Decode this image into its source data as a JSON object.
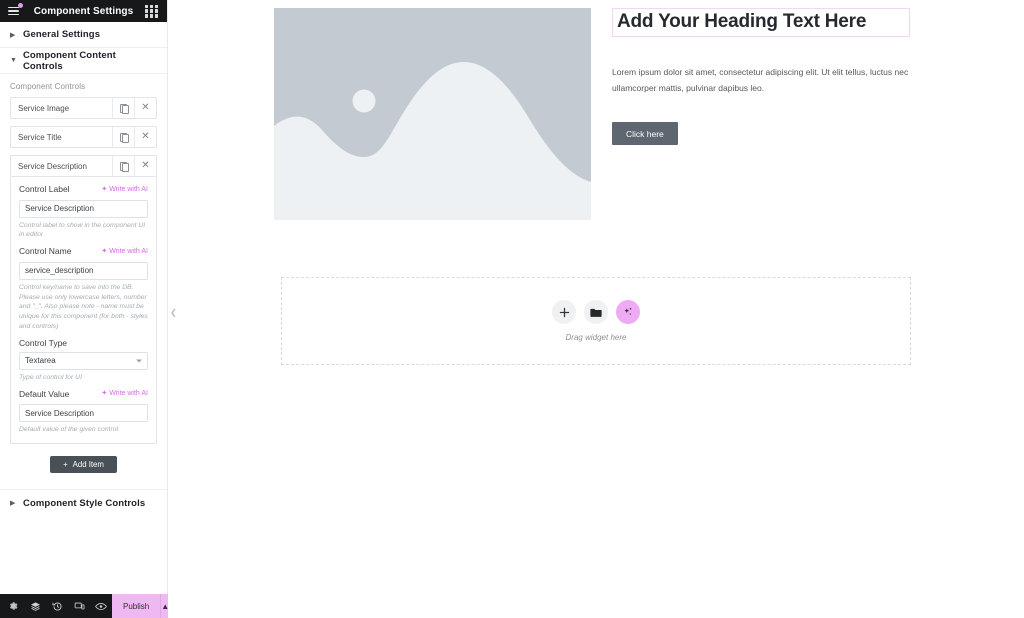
{
  "panel": {
    "title": "Component Settings",
    "menu_icon": "hamburger-icon",
    "apps_icon": "grid-icon",
    "sections": [
      {
        "id": "general",
        "label": "General Settings",
        "expanded": false
      },
      {
        "id": "content",
        "label": "Component Content Controls",
        "expanded": true
      },
      {
        "id": "style",
        "label": "Component Style Controls",
        "expanded": false
      }
    ],
    "content_controls": {
      "group_label": "Component Controls",
      "items": [
        {
          "title": "Service Image",
          "expanded": false
        },
        {
          "title": "Service Title",
          "expanded": false
        },
        {
          "title": "Service Description",
          "expanded": true
        }
      ],
      "expanded_item": {
        "control_label": {
          "label": "Control Label",
          "ai_action": "Write with AI",
          "value": "Service Description",
          "helper": "Control label to show in the component UI in editor"
        },
        "control_name": {
          "label": "Control Name",
          "ai_action": "Write with AI",
          "value": "service_description",
          "helper": "Control key/name to save into the DB. Please use only lowercase letters, number and \"_\". Also please note - name must be unique for this component (for both - styles and controls)"
        },
        "control_type": {
          "label": "Control Type",
          "value": "Textarea",
          "helper": "Type of control for UI"
        },
        "default_value": {
          "label": "Default Value",
          "ai_action": "Write with AI",
          "value": "Service Description",
          "helper": "Default value of the given control"
        },
        "row_actions": {
          "duplicate": "duplicate-icon",
          "remove": "remove-icon"
        }
      },
      "add_item_label": "Add Item"
    },
    "footer": {
      "tools": [
        {
          "name": "settings-icon",
          "glyph": "⚙"
        },
        {
          "name": "navigator-icon",
          "glyph": "≣"
        },
        {
          "name": "history-icon",
          "glyph": "↺"
        },
        {
          "name": "responsive-icon",
          "glyph": "❐"
        },
        {
          "name": "preview-icon",
          "glyph": "◉"
        }
      ],
      "publish_label": "Publish",
      "publish_caret": "chevron-up-icon",
      "publish_color": "#efb8f3"
    },
    "collapse_handle": "collapse-panel-icon"
  },
  "canvas": {
    "image_placeholder": {
      "alt": "image-placeholder",
      "bg_color": "#c3cad1",
      "shape_color": "#eceff2"
    },
    "heading": "Add Your Heading Text Here",
    "paragraph": "Lorem ipsum dolor sit amet, consectetur adipiscing elit. Ut elit tellus, luctus nec ullamcorper mattis, pulvinar dapibus leo.",
    "button_label": "Click here",
    "selection_color": "#f0d7f3",
    "drop_zone": {
      "label": "Drag widget here",
      "buttons": [
        {
          "name": "add-element-button",
          "glyph": "+",
          "variant": "default"
        },
        {
          "name": "folder-templates-button",
          "glyph": "▰",
          "variant": "default"
        },
        {
          "name": "ai-builder-button",
          "glyph": "✦",
          "variant": "ai"
        }
      ]
    }
  }
}
